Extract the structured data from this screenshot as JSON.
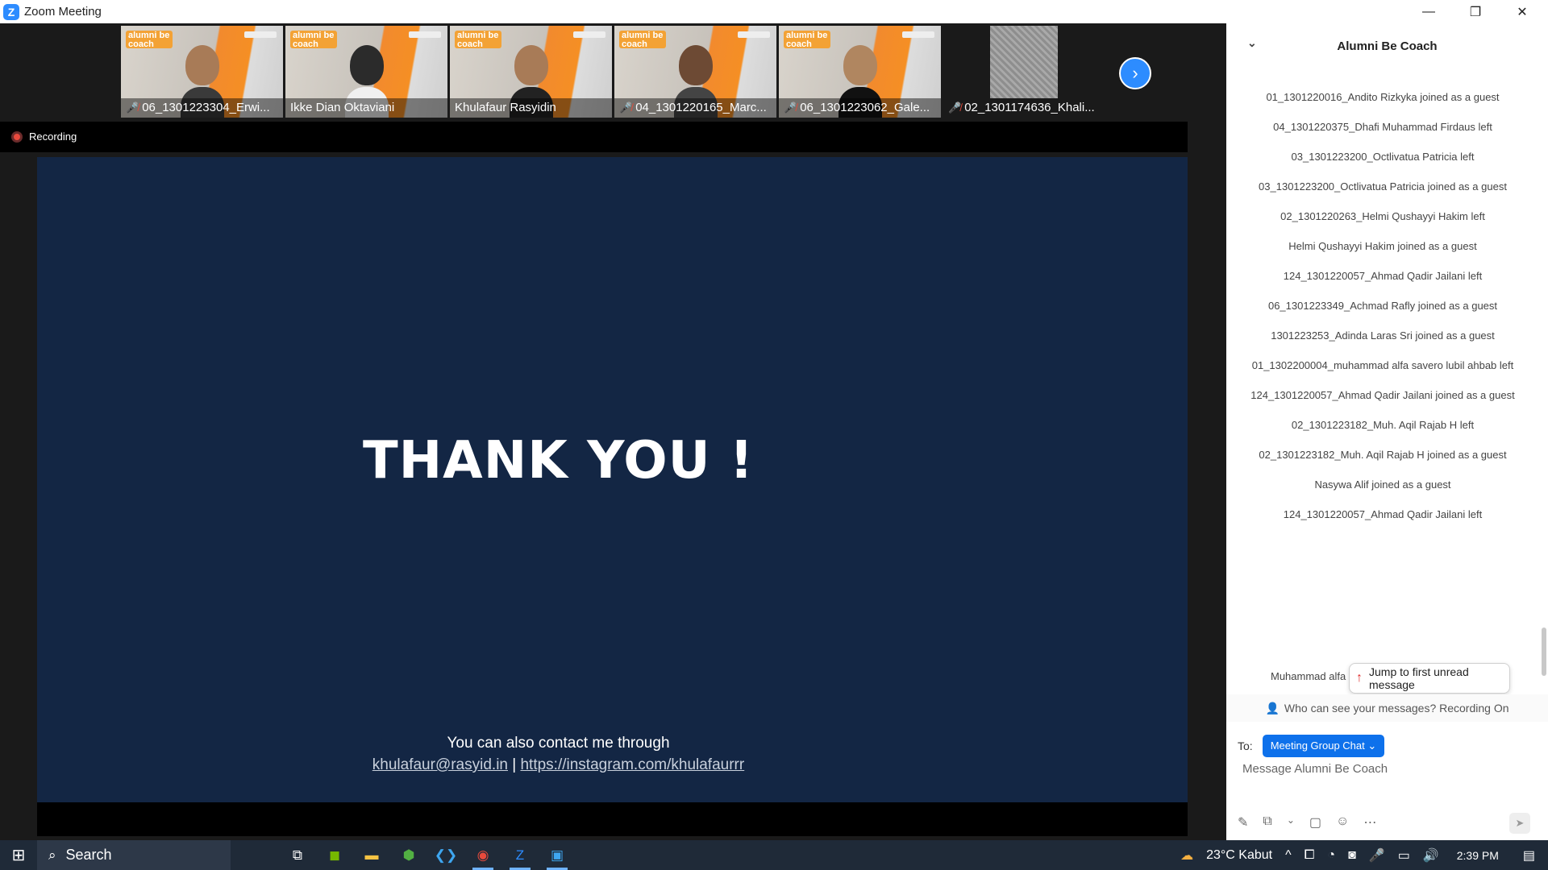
{
  "window": {
    "title": "Zoom Meeting",
    "logo_letter": "Z",
    "minimize": "—",
    "maximize": "❐",
    "close": "✕"
  },
  "participants": [
    {
      "name": "06_1301223304_Erwi...",
      "muted": true,
      "badge": "alumni be coach",
      "active": false
    },
    {
      "name": "Ikke Dian Oktaviani",
      "muted": false,
      "badge": "alumni be coach",
      "active": true
    },
    {
      "name": "Khulafaur Rasyidin",
      "muted": false,
      "badge": "alumni be coach",
      "active": false
    },
    {
      "name": "04_1301220165_Marc...",
      "muted": true,
      "badge": "alumni be coach",
      "active": false
    },
    {
      "name": "06_1301223062_Gale...",
      "muted": true,
      "badge": "alumni be coach",
      "active": false
    },
    {
      "name": "02_1301174636_Khali...",
      "muted": true,
      "badge": "",
      "active": false
    }
  ],
  "recording": {
    "label": "Recording"
  },
  "slide": {
    "heading": "THANK YOU !",
    "contact_line": "You can also contact me through",
    "email": "khulafaur@rasyid.in",
    "separator": "|",
    "instagram": "https://instagram.com/khulafaurrr"
  },
  "chat": {
    "title": "Alumni Be Coach",
    "messages": [
      "01_1301220016_Andito Rizkyka joined as a guest",
      "04_1301220375_Dhafi Muhammad Firdaus left",
      "03_1301223200_Octlivatua Patricia left",
      "03_1301223200_Octlivatua Patricia joined as a guest",
      "02_1301220263_Helmi Qushayyi Hakim left",
      "Helmi Qushayyi Hakim joined as a guest",
      "124_1301220057_Ahmad Qadir Jailani left",
      "06_1301223349_Achmad Rafly joined as a guest",
      "1301223253_Adinda Laras Sri joined as a guest",
      "01_1302200004_muhammad alfa savero lubil ahbab left",
      "124_1301220057_Ahmad Qadir Jailani joined as a guest",
      "02_1301223182_Muh. Aqil Rajab H left",
      "02_1301223182_Muh. Aqil Rajab H joined as a guest",
      "Nasywa Alif joined as a guest",
      "124_1301220057_Ahmad Qadir Jailani left"
    ],
    "partial_message": "Muhammad alfa",
    "jump_label": "Jump to first unread message",
    "visibility_note": "Who can see your messages? Recording On",
    "to_label": "To:",
    "recipient": "Meeting Group Chat ⌄",
    "input_placeholder": "Message Alumni Be Coach"
  },
  "taskbar": {
    "search_label": "Search",
    "weather": "23°C  Kabut",
    "time": "2:39 PM"
  }
}
